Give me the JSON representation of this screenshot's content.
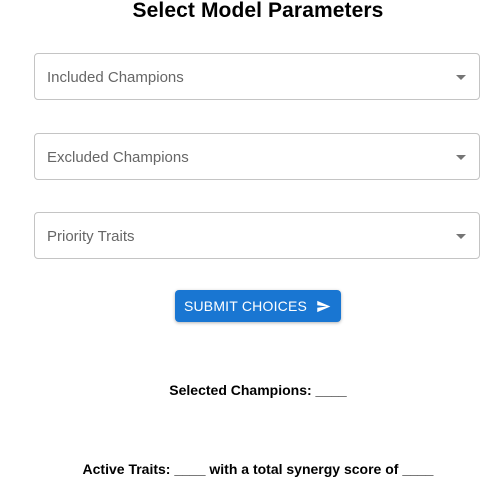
{
  "header": {
    "title": "Select Model Parameters"
  },
  "form": {
    "fields": [
      {
        "label": "Included Champions"
      },
      {
        "label": "Excluded Champions"
      },
      {
        "label": "Priority Traits"
      }
    ],
    "submit_label": "SUBMIT CHOICES"
  },
  "results": {
    "selected_champions": "Selected Champions: ____",
    "active_traits": "Active Traits: ____ with a total synergy score of ____"
  },
  "colors": {
    "accent": "#1976d2",
    "field_border": "#c4c4c4",
    "label_text": "#666666"
  },
  "icons": {
    "submit": "send-icon",
    "dropdown": "arrow-drop-down-icon"
  }
}
